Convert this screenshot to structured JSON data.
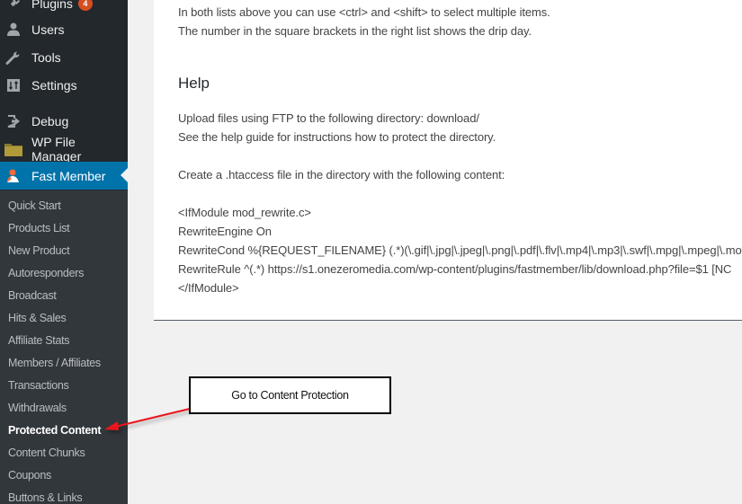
{
  "sidebar": {
    "menu": [
      {
        "label": "Plugins",
        "icon": "plugins-icon",
        "badge": "4"
      },
      {
        "label": "Users",
        "icon": "users-icon"
      },
      {
        "label": "Tools",
        "icon": "tools-icon"
      },
      {
        "label": "Settings",
        "icon": "settings-icon"
      },
      {
        "label": "Debug",
        "icon": "debug-icon"
      },
      {
        "label": "WP File Manager",
        "icon": "folder-icon"
      },
      {
        "label": "Fast Member",
        "icon": "fast-member-icon",
        "active": true
      }
    ],
    "submenu": [
      {
        "label": "Quick Start"
      },
      {
        "label": "Products List"
      },
      {
        "label": "New Product"
      },
      {
        "label": "Autoresponders"
      },
      {
        "label": "Broadcast"
      },
      {
        "label": "Hits & Sales"
      },
      {
        "label": "Affiliate Stats"
      },
      {
        "label": "Members / Affiliates"
      },
      {
        "label": "Transactions"
      },
      {
        "label": "Withdrawals"
      },
      {
        "label": "Protected Content",
        "current": true
      },
      {
        "label": "Content Chunks"
      },
      {
        "label": "Coupons"
      },
      {
        "label": "Buttons & Links"
      }
    ]
  },
  "content": {
    "intro_lines": [
      "In both lists above you can use <ctrl> and <shift> to select multiple items.",
      "The number in the square brackets in the right list shows the drip day."
    ],
    "help_heading": "Help",
    "help_lines": [
      "Upload files using FTP to the following directory: download/",
      "See the help guide for instructions how to protect the directory.",
      "",
      "Create a .htaccess file in the directory with the following content:",
      "",
      "<IfModule mod_rewrite.c>",
      "RewriteEngine On",
      "RewriteCond %{REQUEST_FILENAME} (.*)(\\.gif|\\.jpg|\\.jpeg|\\.png|\\.pdf|\\.flv|\\.mp4|\\.mp3|\\.swf|\\.mpg|\\.mpeg|\\.mov",
      "RewriteRule ^(.*) https://s1.onezeromedia.com/wp-content/plugins/fastmember/lib/download.php?file=$1 [NC",
      "</IfModule>"
    ]
  },
  "annotation": {
    "callout_text": "Go to Content Protection",
    "arrow_color": "#e8191e"
  },
  "colors": {
    "sidebar_bg": "#23282d",
    "submenu_bg": "#32373c",
    "active_bg": "#0073aa",
    "badge_bg": "#d54e21"
  }
}
